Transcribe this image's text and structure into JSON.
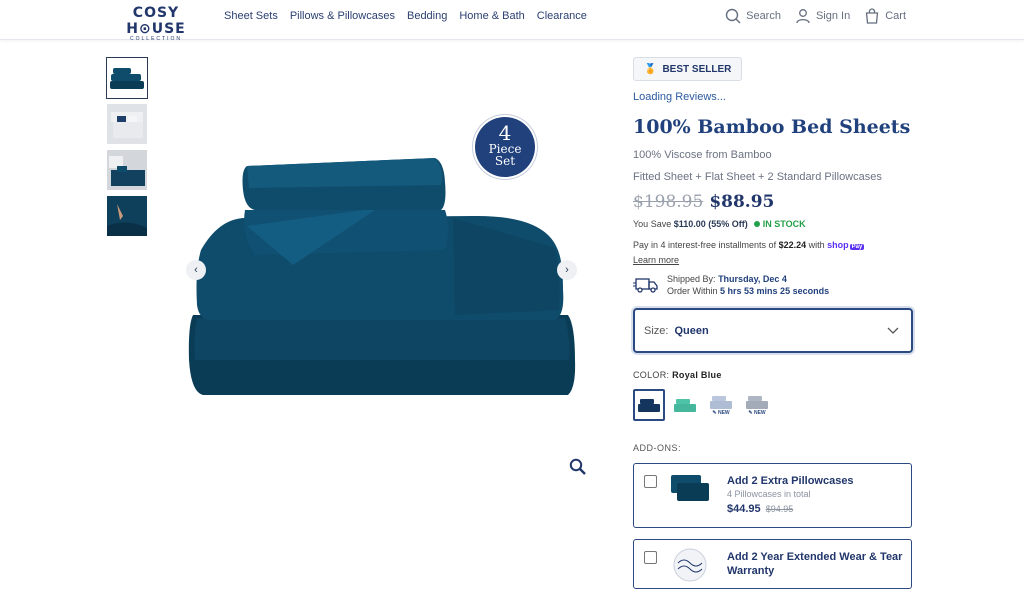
{
  "header": {
    "logo_main": "COSY H⊙USE",
    "logo_sub": "COLLECTION",
    "nav": [
      "Sheet Sets",
      "Pillows & Pillowcases",
      "Bedding",
      "Home & Bath",
      "Clearance"
    ],
    "search": "Search",
    "signin": "Sign In",
    "cart": "Cart"
  },
  "gallery": {
    "badge_num": "4",
    "badge_line1": "Piece",
    "badge_line2": "Set",
    "colors": {
      "sheet": "#0f4c6b",
      "sheet_dark": "#0b3c56",
      "sheet_light": "#1a6286"
    }
  },
  "product": {
    "badge": "BEST SELLER",
    "reviews": "Loading Reviews...",
    "title": "100% Bamboo Bed Sheets",
    "subtitle": "100% Viscose from Bamboo",
    "contents": "Fitted Sheet + Flat Sheet + 2 Standard Pillowcases",
    "old_price": "$198.95",
    "price": "$88.95",
    "save_prefix": "You Save",
    "save_amount": "$110.00 (55% Off)",
    "stock": "IN STOCK",
    "pay_prefix": "Pay in 4 interest-free installments of",
    "pay_amount": "$22.24",
    "pay_with": "with",
    "shop_pay": "shop",
    "shop_pay_tag": "Pay",
    "learn_more": "Learn more",
    "ship_label": "Shipped By:",
    "ship_date": "Thursday, Dec 4",
    "order_within": "Order Within",
    "countdown": "5 hrs 53 mins 25 seconds",
    "size_label": "Size:",
    "size_value": "Queen",
    "color_label": "COLOR:",
    "color_value": "Royal Blue",
    "swatches": [
      {
        "color": "#14355e",
        "new": ""
      },
      {
        "color": "#4fc3a8",
        "new": ""
      },
      {
        "color": "#b9c6dc",
        "new": "✎ NEW"
      },
      {
        "color": "#aeb6c4",
        "new": "✎ NEW"
      }
    ],
    "addons_label": "ADD-ONS:",
    "addon1_title": "Add 2 Extra Pillowcases",
    "addon1_sub": "4 Pillowcases in total",
    "addon1_price": "$44.95",
    "addon1_old": "$94.95",
    "addon2_title_1": "Add 2 Year Extended Wear & Tear",
    "addon2_title_2": "Warranty"
  }
}
